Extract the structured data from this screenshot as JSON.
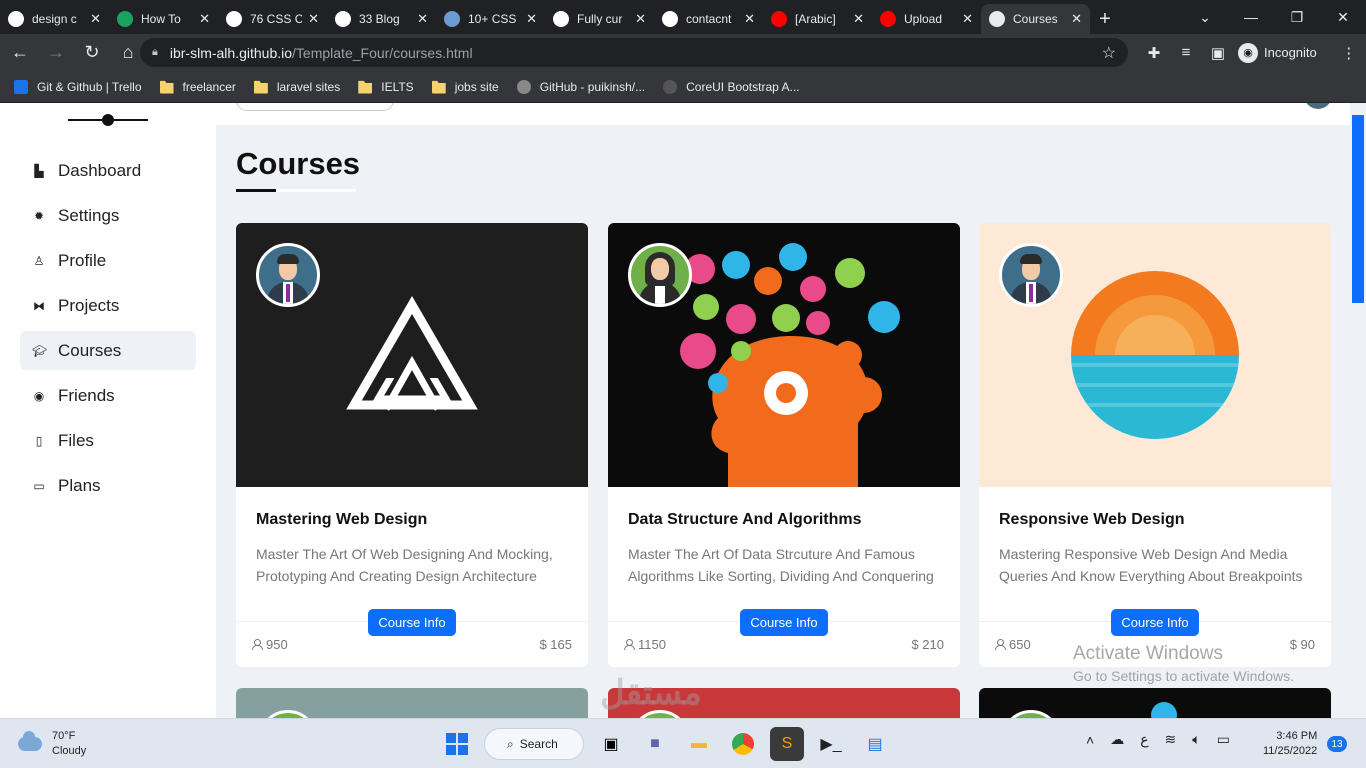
{
  "browser": {
    "tabs": [
      {
        "title": "design c",
        "favicon": "google-icon",
        "color": "#ffffff"
      },
      {
        "title": "How To",
        "favicon": "w-icon",
        "color": "#1aa260"
      },
      {
        "title": "76 CSS C",
        "favicon": "f-icon",
        "color": "#ffffff"
      },
      {
        "title": "33 Blog",
        "favicon": "medium-icon",
        "color": "#ffffff"
      },
      {
        "title": "10+ CSS",
        "favicon": "doc-icon",
        "color": "#6b9bd1"
      },
      {
        "title": "Fully cur",
        "favicon": "codepen-icon",
        "color": "#ffffff"
      },
      {
        "title": "contacnt",
        "favicon": "google-icon",
        "color": "#ffffff"
      },
      {
        "title": "[Arabic]",
        "favicon": "youtube-icon",
        "color": "#ff0000"
      },
      {
        "title": "Upload",
        "favicon": "youtube-icon",
        "color": "#ff0000"
      },
      {
        "title": "Courses",
        "favicon": "globe-icon",
        "color": "#e8eaed",
        "active": true
      }
    ],
    "url_host": "ibr-slm-alh.github.io",
    "url_path": "/Template_Four/courses.html",
    "profile_label": "Incognito",
    "bookmarks": [
      {
        "label": "Git & Github | Trello",
        "icon": "trello-icon"
      },
      {
        "label": "freelancer",
        "icon": "folder-icon"
      },
      {
        "label": "laravel sites",
        "icon": "folder-icon"
      },
      {
        "label": "IELTS",
        "icon": "folder-icon"
      },
      {
        "label": "jobs site",
        "icon": "folder-icon"
      },
      {
        "label": "GitHub - puikinsh/...",
        "icon": "github-icon"
      },
      {
        "label": "CoreUI Bootstrap A...",
        "icon": "coreui-icon"
      }
    ]
  },
  "sidebar": {
    "items": [
      {
        "label": "Dashboard",
        "icon": "chart-icon"
      },
      {
        "label": "Settings",
        "icon": "gear-icon"
      },
      {
        "label": "Profile",
        "icon": "user-icon"
      },
      {
        "label": "Projects",
        "icon": "diagram-icon"
      },
      {
        "label": "Courses",
        "icon": "graduation-cap-icon",
        "active": true
      },
      {
        "label": "Friends",
        "icon": "circle-user-icon"
      },
      {
        "label": "Files",
        "icon": "file-icon"
      },
      {
        "label": "Plans",
        "icon": "credit-card-icon"
      }
    ]
  },
  "main": {
    "title": "Courses",
    "button_label": "Course Info",
    "cards": [
      {
        "title": "Mastering Web Design",
        "description": "Master The Art Of Web Designing And Mocking, Prototyping And Creating Design Architecture",
        "students": "950",
        "price": "$ 165"
      },
      {
        "title": "Data Structure And Algorithms",
        "description": "Master The Art Of Data Strcuture And Famous Algorithms Like Sorting, Dividing And Conquering",
        "students": "1150",
        "price": "$ 210"
      },
      {
        "title": "Responsive Web Design",
        "description": "Mastering Responsive Web Design And Media Queries And Know Everything About Breakpoints",
        "students": "650",
        "price": "$ 90"
      }
    ]
  },
  "overlay": {
    "activate_title": "Activate Windows",
    "activate_sub": "Go to Settings to activate Windows.",
    "watermark": "مستقل"
  },
  "taskbar": {
    "weather_temp": "70°F",
    "weather_desc": "Cloudy",
    "search_label": "Search",
    "lang": "ع",
    "time": "3:46 PM",
    "date": "11/25/2022",
    "notifications": "13"
  }
}
